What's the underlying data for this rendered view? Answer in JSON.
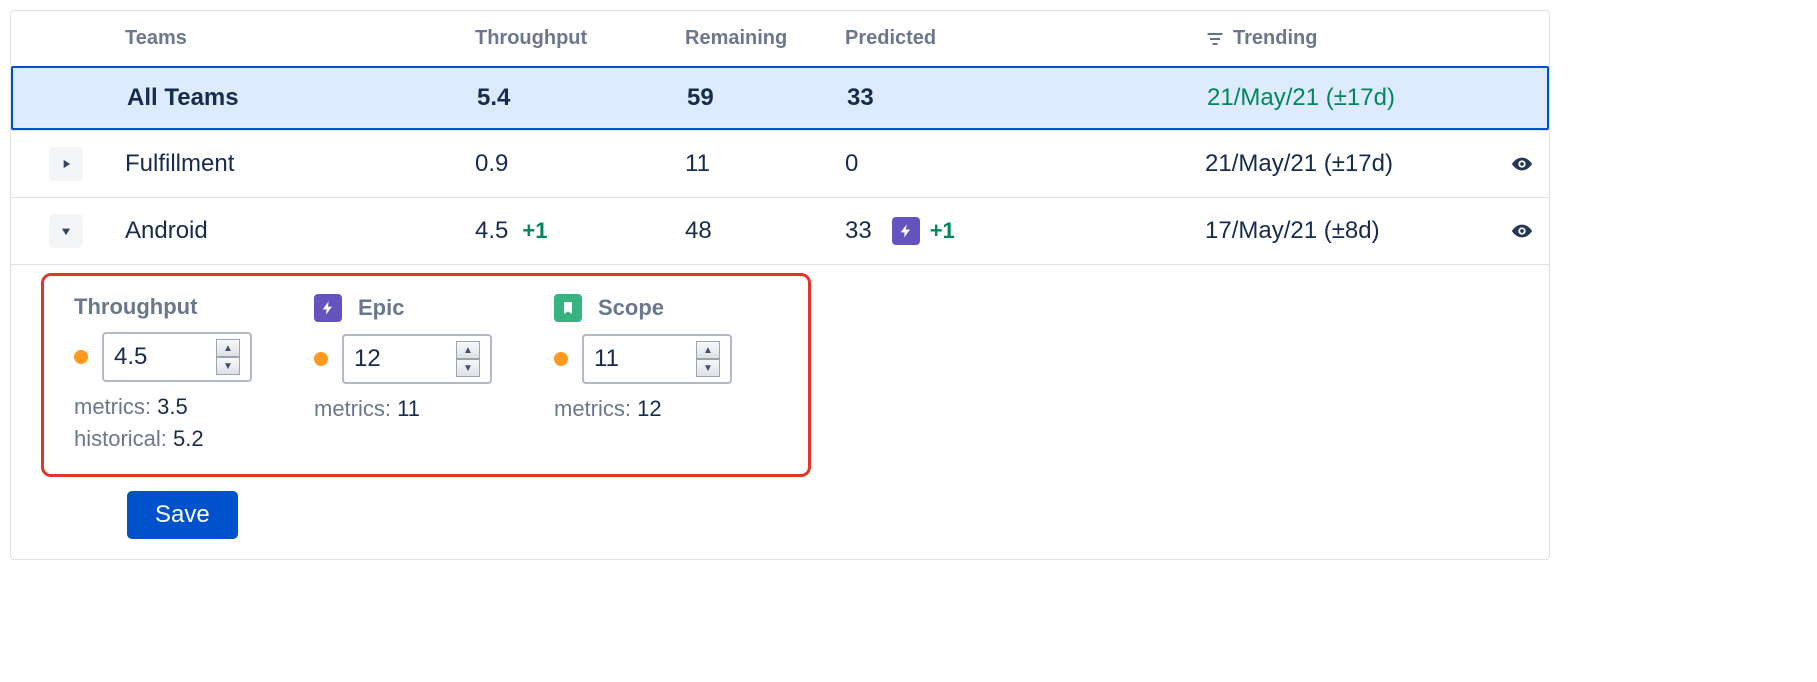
{
  "columns": {
    "teams": "Teams",
    "throughput": "Throughput",
    "remaining": "Remaining",
    "predicted": "Predicted",
    "trending": "Trending"
  },
  "rows": {
    "all": {
      "name": "All Teams",
      "throughput": "5.4",
      "remaining": "59",
      "predicted": "33",
      "trending": "21/May/21 (±17d)"
    },
    "fulfillment": {
      "name": "Fulfillment",
      "throughput": "0.9",
      "remaining": "11",
      "predicted": "0",
      "trending": "21/May/21 (±17d)"
    },
    "android": {
      "name": "Android",
      "throughput": "4.5",
      "throughput_delta": "+1",
      "remaining": "48",
      "predicted": "33",
      "predicted_delta": "+1",
      "trending": "17/May/21 (±8d)"
    }
  },
  "panel": {
    "throughput": {
      "label": "Throughput",
      "value": "4.5",
      "metrics": "3.5",
      "historical": "5.2"
    },
    "epic": {
      "label": "Epic",
      "value": "12",
      "metrics": "11"
    },
    "scope": {
      "label": "Scope",
      "value": "11",
      "metrics": "12"
    },
    "metrics_prefix": "metrics: ",
    "historical_prefix": "historical: "
  },
  "buttons": {
    "save": "Save"
  }
}
